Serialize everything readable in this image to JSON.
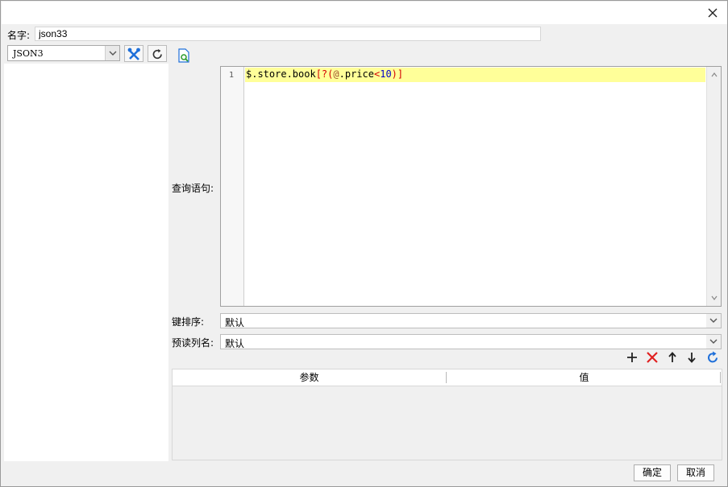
{
  "dialog": {
    "name_label": "名字:",
    "name_value": "json33",
    "datasource": "JSON3",
    "query_label": "查询语句:",
    "code": {
      "line_number": "1",
      "path": "$.store.book",
      "open_bracket": "[?(",
      "at": "@",
      "field": ".price",
      "lt": "<",
      "number": "10",
      "close_bracket": ")]"
    },
    "sort_label": "键排序:",
    "sort_value": "默认",
    "preread_label": "预读列名:",
    "preread_value": "默认",
    "params_table": {
      "columns": [
        "参数",
        "值"
      ]
    },
    "ok_label": "确定",
    "cancel_label": "取消"
  },
  "colors": {
    "highlight_line": "#ffff99",
    "accent_blue": "#1e6fd9",
    "delete_red": "#e02020"
  }
}
